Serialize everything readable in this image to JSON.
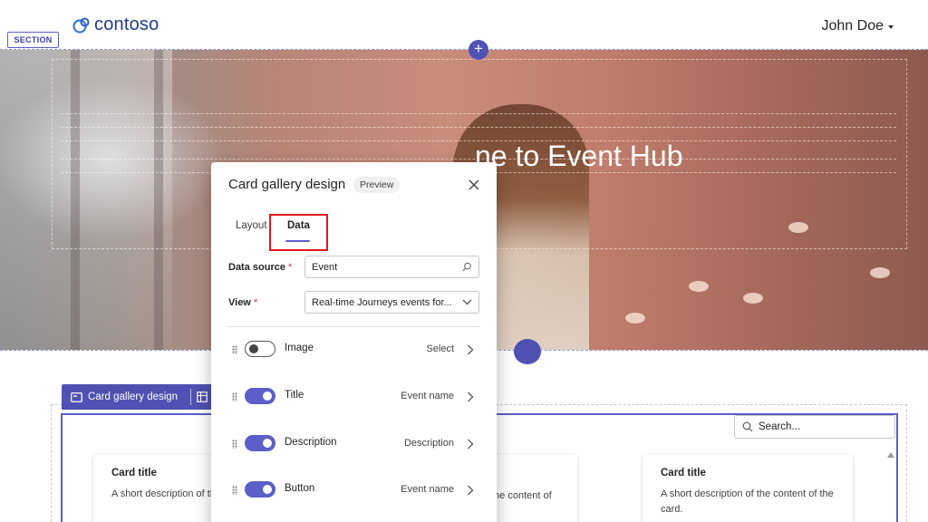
{
  "header": {
    "logo_text": "contoso",
    "user_name": "John Doe"
  },
  "section": {
    "tag_label": "SECTION",
    "add_symbol": "+"
  },
  "hero": {
    "title_visible": "ne to Event Hub"
  },
  "gallery": {
    "toolbar_label": "Card gallery design",
    "search_placeholder": "Search...",
    "cards": [
      {
        "title": "Card title",
        "description": "A short description of the card."
      },
      {
        "title": "",
        "description": "the content of"
      },
      {
        "title": "Card title",
        "description": "A short description of the content of the card."
      }
    ]
  },
  "dialog": {
    "title": "Card gallery design",
    "badge": "Preview",
    "tabs": [
      {
        "label": "Layout",
        "selected": false
      },
      {
        "label": "Data",
        "selected": true
      }
    ],
    "data_source_label": "Data source",
    "data_source_value": "Event",
    "view_label": "View",
    "view_value": "Real-time Journeys events for...",
    "required_mark": "*",
    "fields": [
      {
        "label": "Image",
        "enabled": false,
        "value": "Select"
      },
      {
        "label": "Title",
        "enabled": true,
        "value": "Event name"
      },
      {
        "label": "Description",
        "enabled": true,
        "value": "Description"
      },
      {
        "label": "Button",
        "enabled": true,
        "value": "Event name"
      }
    ]
  },
  "colors": {
    "accent": "#5b5fc7",
    "highlight": "#e3161b"
  }
}
